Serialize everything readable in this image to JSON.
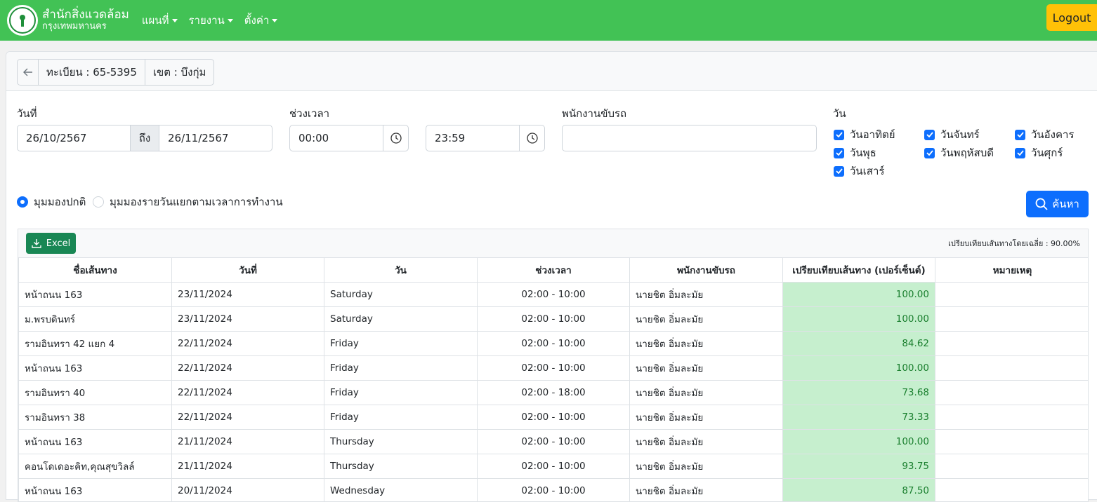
{
  "nav": {
    "brand_line1": "สำนักสิ่งแวดล้อม",
    "brand_line2": "กรุงเทพมหานคร",
    "menu": [
      "แผนที่",
      "รายงาน",
      "ตั้งค่า"
    ],
    "logout": "Logout"
  },
  "header": {
    "plate": "ทะเบียน : 65-5395",
    "district": "เขต : บึงกุ่ม"
  },
  "filters": {
    "date_label": "วันที่",
    "date_from": "26/10/2567",
    "to_label": "ถึง",
    "date_to": "26/11/2567",
    "time_label": "ช่วงเวลา",
    "time_from": "00:00",
    "time_to": "23:59",
    "driver_label": "พนักงานขับรถ",
    "driver_value": "",
    "day_label": "วัน",
    "days": [
      "วันอาทิตย์",
      "วันจันทร์",
      "วันอังคาร",
      "วันพุธ",
      "วันพฤหัสบดี",
      "วันศุกร์",
      "วันเสาร์"
    ],
    "view_normal": "มุมมองปกติ",
    "view_daily": "มุมมองรายวันแยกตามเวลาการทำงาน",
    "search_label": "ค้นหา"
  },
  "table": {
    "excel_label": "Excel",
    "average_text": "เปรียบเทียบเส้นทางโดยเฉลี่ย : 90.00%",
    "columns": [
      "ชื่อเส้นทาง",
      "วันที่",
      "วัน",
      "ช่วงเวลา",
      "พนักงานขับรถ",
      "เปรียบเทียบเส้นทาง (เปอร์เซ็นต์)",
      "หมายเหตุ"
    ],
    "rows": [
      [
        "หน้าถนน 163",
        "23/11/2024",
        "Saturday",
        "02:00 - 10:00",
        "นายชิต อิ่มละมัย",
        "100.00",
        ""
      ],
      [
        "ม.พรบดินทร์",
        "23/11/2024",
        "Saturday",
        "02:00 - 10:00",
        "นายชิต อิ่มละมัย",
        "100.00",
        ""
      ],
      [
        "รามอินทรา 42 แยก 4",
        "22/11/2024",
        "Friday",
        "02:00 - 10:00",
        "นายชิต อิ่มละมัย",
        "84.62",
        ""
      ],
      [
        "หน้าถนน 163",
        "22/11/2024",
        "Friday",
        "02:00 - 10:00",
        "นายชิต อิ่มละมัย",
        "100.00",
        ""
      ],
      [
        "รามอินทรา 40",
        "22/11/2024",
        "Friday",
        "02:00 - 18:00",
        "นายชิต อิ่มละมัย",
        "73.68",
        ""
      ],
      [
        "รามอินทรา 38",
        "22/11/2024",
        "Friday",
        "02:00 - 10:00",
        "นายชิต อิ่มละมัย",
        "73.33",
        ""
      ],
      [
        "หน้าถนน 163",
        "21/11/2024",
        "Thursday",
        "02:00 - 10:00",
        "นายชิต อิ่มละมัย",
        "100.00",
        ""
      ],
      [
        "คอนโดเดอะคิท,คุณสุขวิลล์",
        "21/11/2024",
        "Thursday",
        "02:00 - 10:00",
        "นายชิต อิ่มละมัย",
        "93.75",
        ""
      ],
      [
        "หน้าถนน 163",
        "20/11/2024",
        "Wednesday",
        "02:00 - 10:00",
        "นายชิต อิ่มละมัย",
        "87.50",
        ""
      ]
    ]
  }
}
